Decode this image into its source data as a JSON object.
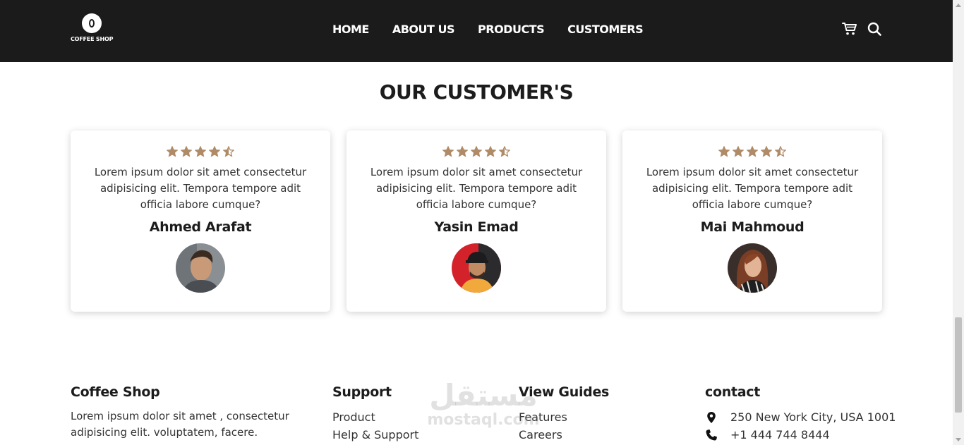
{
  "header": {
    "logo_text": "COFFEE SHOP",
    "nav": [
      "HOME",
      "ABOUT US",
      "PRODUCTS",
      "CUSTOMERS"
    ],
    "icons": [
      "cart-icon",
      "search-icon"
    ]
  },
  "customers": {
    "title": "OUR CUSTOMER'S",
    "rating": 4.5,
    "star_color": "#b08b67",
    "cards": [
      {
        "text": "Lorem ipsum dolor sit amet consectetur adipisicing elit. Tempora tempore adit officia labore cumque?",
        "name": "Ahmed Arafat"
      },
      {
        "text": "Lorem ipsum dolor sit amet consectetur adipisicing elit. Tempora tempore adit officia labore cumque?",
        "name": "Yasin Emad"
      },
      {
        "text": "Lorem ipsum dolor sit amet consectetur adipisicing elit. Tempora tempore adit officia labore cumque?",
        "name": "Mai Mahmoud"
      }
    ]
  },
  "footer": {
    "about": {
      "title": "Coffee Shop",
      "text": "Lorem ipsum dolor sit amet , consectetur adipisicing elit. voluptatem, facere."
    },
    "support": {
      "title": "Support",
      "links": [
        "Product",
        "Help & Support"
      ]
    },
    "guides": {
      "title": "View Guides",
      "links": [
        "Features",
        "Careers"
      ]
    },
    "contact": {
      "title": "contact",
      "address": "250 New York City, USA 1001",
      "phone": "+1 444 744 8444"
    }
  },
  "watermark": {
    "arabic": "مستقل",
    "latin": "mostaql.com"
  },
  "colors": {
    "header_bg": "#1b1b1b",
    "accent": "#b08b67"
  }
}
